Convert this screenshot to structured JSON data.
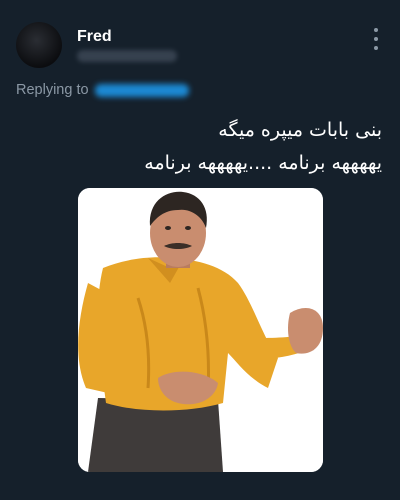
{
  "author": {
    "display_name": "Fred"
  },
  "reply": {
    "prefix": "Replying to"
  },
  "tweet": {
    "lines": [
      "بنی بابات میپره میگه",
      "یههههه برنامه ....یههههه برنامه"
    ]
  },
  "icons": {
    "more": "more-vertical-icon"
  },
  "colors": {
    "background": "#15202b",
    "text_primary": "#ffffff",
    "text_secondary": "#8b98a5",
    "accent": "#1d9bf0",
    "photo_shirt": "#e8a62a"
  }
}
